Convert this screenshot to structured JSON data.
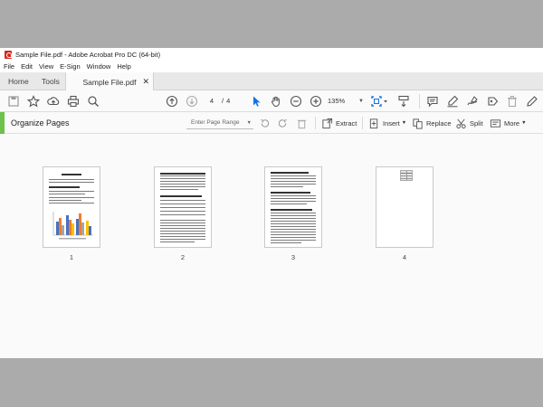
{
  "window": {
    "title": "Sample File.pdf - Adobe Acrobat Pro DC (64-bit)"
  },
  "menu": [
    "File",
    "Edit",
    "View",
    "E-Sign",
    "Window",
    "Help"
  ],
  "tabs": {
    "home": "Home",
    "tools": "Tools",
    "document": "Sample File.pdf",
    "close": "✕"
  },
  "toolbar": {
    "current_page": "4",
    "separator": "/",
    "total_pages": "4",
    "zoom": "135%",
    "icons": [
      "save-icon",
      "bookmark-star-icon",
      "upload-icon",
      "print-icon",
      "search-icon",
      "page-up-icon",
      "page-down-icon",
      "select-cursor-icon",
      "hand-icon",
      "zoom-out-icon",
      "zoom-in-icon",
      "fit-page-icon",
      "scroll-mode-icon",
      "comment-icon",
      "highlight-icon",
      "sign-icon",
      "stamp-icon",
      "delete-icon",
      "edit-icon"
    ]
  },
  "organize": {
    "title": "Organize Pages",
    "range_placeholder": "Enter Page Range",
    "extract": "Extract",
    "insert": "Insert",
    "replace": "Replace",
    "split": "Split",
    "more": "More"
  },
  "pages": [
    {
      "number": "1"
    },
    {
      "number": "2"
    },
    {
      "number": "3"
    },
    {
      "number": "4"
    }
  ],
  "colors": {
    "accent_green": "#6cc24a",
    "toolbar_blue": "#1473e6",
    "acrobat_red": "#d7261b"
  }
}
